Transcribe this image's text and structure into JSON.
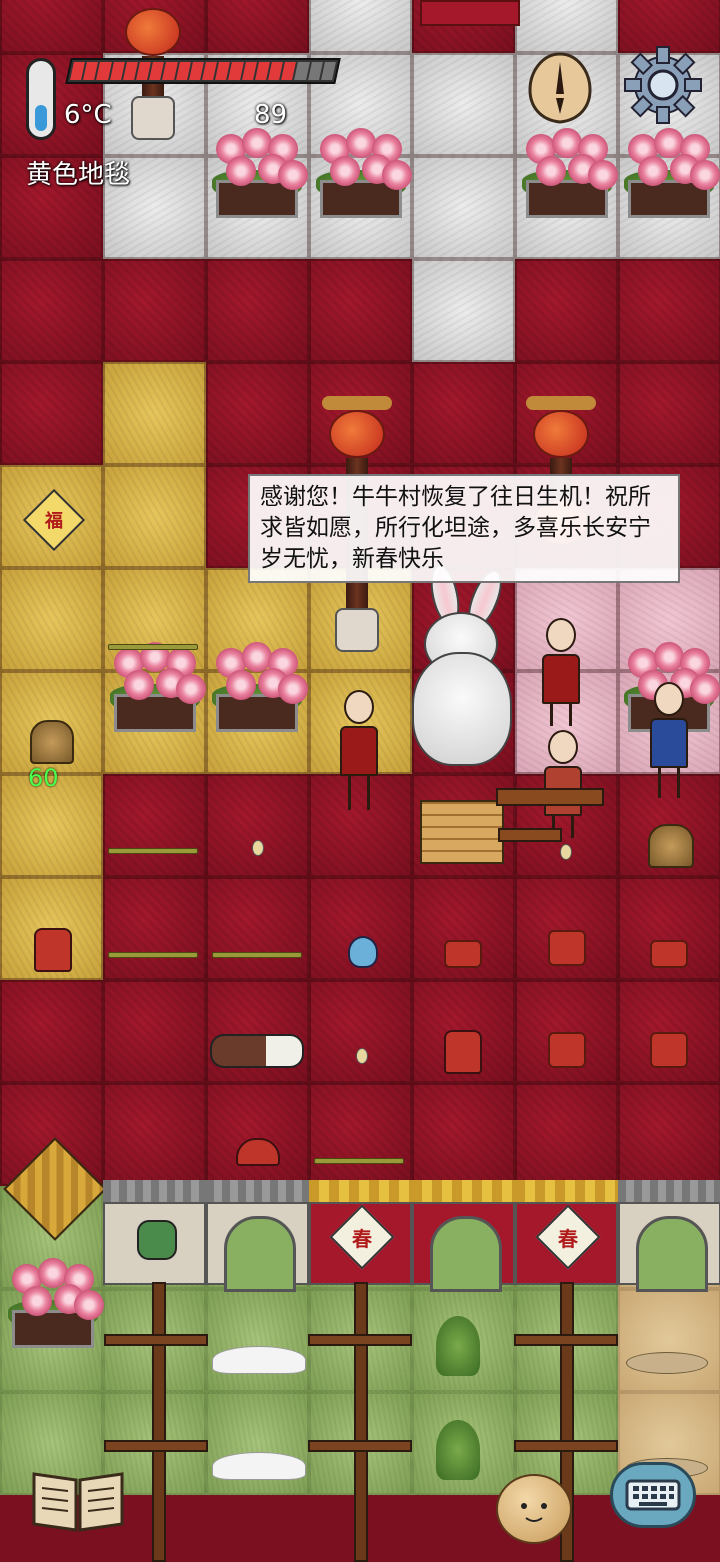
{
  "hud": {
    "temperature": "6°C",
    "health_value": "89",
    "health_fraction": 0.85,
    "tile_label": "黄色地毯",
    "count_badge": "60"
  },
  "dialog": {
    "text": "感谢您！牛牛村恢复了往日生机！祝所求皆如愿，所行化坦途，多喜乐长安宁岁无忧，新春快乐"
  },
  "signs": {
    "fu": "福",
    "spring": "春"
  },
  "icons": {
    "thermometer": "thermometer-icon",
    "clock": "clock-icon",
    "settings": "gear-icon",
    "journal": "book-icon",
    "keyboard": "keyboard-icon"
  },
  "colors": {
    "health": "#e23a3a",
    "counter": "#4cff4c",
    "carpet_red": "#a3182c",
    "carpet_yellow": "#e6c65c",
    "carpet_white": "#ececec",
    "carpet_pink": "#f2c6d3"
  }
}
